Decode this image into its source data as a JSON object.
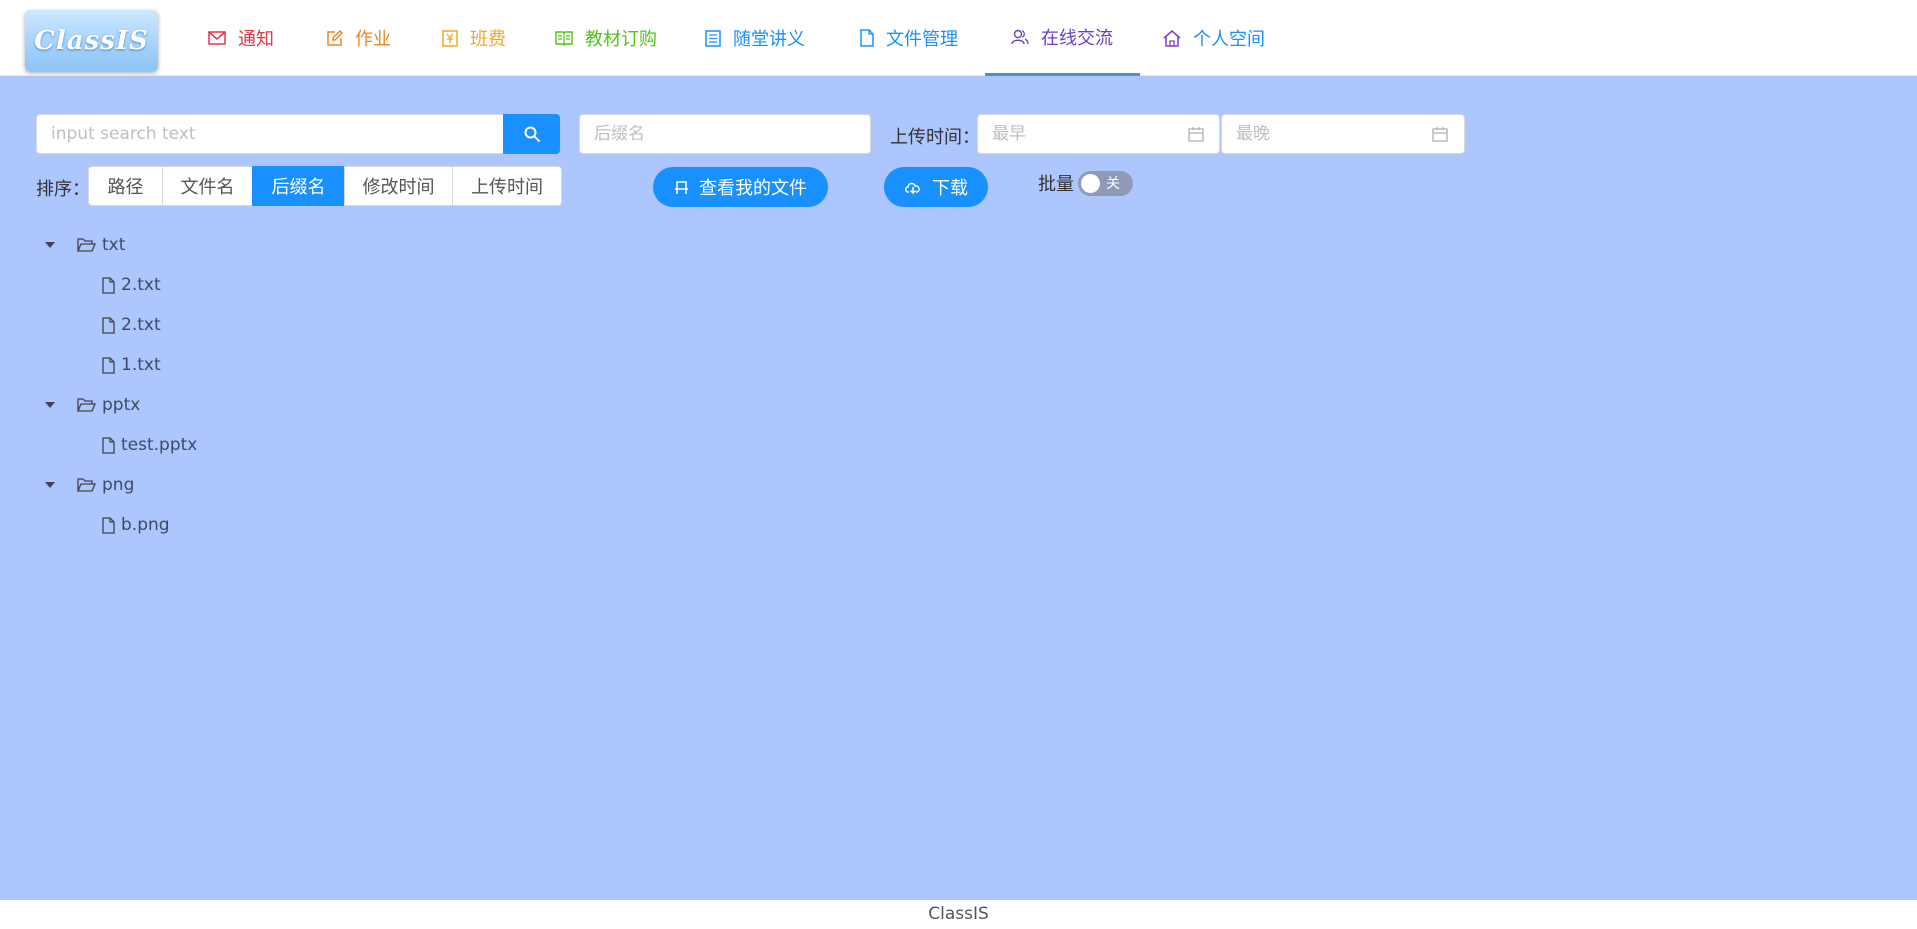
{
  "logo": {
    "text": "ClassIS"
  },
  "nav": {
    "items": [
      {
        "label": "通知",
        "icon": "mail-icon",
        "color": "#e5334a"
      },
      {
        "label": "作业",
        "icon": "edit-icon",
        "color": "#f08522"
      },
      {
        "label": "班费",
        "icon": "money-icon",
        "color": "#f5a623"
      },
      {
        "label": "教材订购",
        "icon": "book-icon",
        "color": "#52c41a"
      },
      {
        "label": "随堂讲义",
        "icon": "list-icon",
        "color": "#1890ff"
      },
      {
        "label": "文件管理",
        "icon": "file-icon",
        "color": "#1890ff"
      },
      {
        "label": "在线交流",
        "icon": "team-icon",
        "color": "#6d3fc0",
        "active": true
      },
      {
        "label": "个人空间",
        "icon": "home-icon",
        "color": "#7b3fc9"
      }
    ]
  },
  "search": {
    "placeholder": "input search text",
    "value": ""
  },
  "suffix_filter": {
    "placeholder": "后缀名",
    "value": ""
  },
  "upload_time": {
    "label": "上传时间：",
    "start_placeholder": "最早",
    "end_placeholder": "最晚"
  },
  "sort": {
    "label": "排序：",
    "options": [
      "路径",
      "文件名",
      "后缀名",
      "修改时间",
      "上传时间"
    ],
    "selected": "后缀名"
  },
  "actions": {
    "my_files": "查看我的文件",
    "download": "下载"
  },
  "batch": {
    "label": "批量",
    "state_text": "关",
    "on": false
  },
  "tree": [
    {
      "folder": "txt",
      "files": [
        "2.txt",
        "2.txt",
        "1.txt"
      ]
    },
    {
      "folder": "pptx",
      "files": [
        "test.pptx"
      ]
    },
    {
      "folder": "png",
      "files": [
        "b.png"
      ]
    }
  ],
  "footer": {
    "text": "ClassIS"
  },
  "colors": {
    "primary": "#1890ff",
    "background": "#adc6fd",
    "tree_text": "#3d4a63"
  }
}
